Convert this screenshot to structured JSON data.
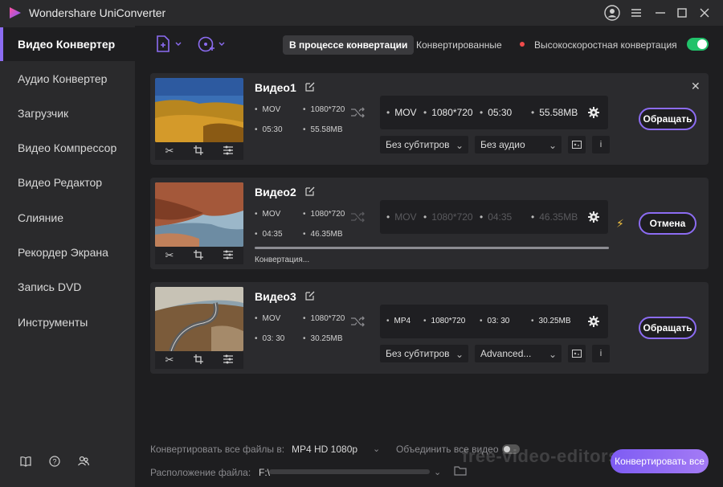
{
  "app": {
    "title": "Wondershare UniConverter"
  },
  "sidebar": {
    "items": [
      {
        "label": "Видео Конвертер",
        "active": true
      },
      {
        "label": "Аудио Конвертер"
      },
      {
        "label": "Загрузчик"
      },
      {
        "label": "Видео Компрессор"
      },
      {
        "label": "Видео Редактор"
      },
      {
        "label": "Слияние"
      },
      {
        "label": "Рекордер Экрана"
      },
      {
        "label": "Запись DVD"
      },
      {
        "label": "Инструменты"
      }
    ],
    "bottom_icons": [
      "book-icon",
      "help-icon",
      "users-icon"
    ]
  },
  "toolbar": {
    "tabs": [
      {
        "label": "В процессе конвертации",
        "active": true
      },
      {
        "label": "Конвертированные"
      }
    ],
    "high_speed_label": "Высокоскоростная конвертация",
    "high_speed_on": true
  },
  "videos": [
    {
      "title": "Видео1",
      "src_format": "MOV",
      "src_res": "1080*720",
      "src_duration": "05:30",
      "src_size": "55.58MB",
      "tgt_format": "MOV",
      "tgt_res": "1080*720",
      "tgt_duration": "05:30",
      "tgt_size": "55.58MB",
      "subtitle": "Без субтитров",
      "audio": "Без аудио",
      "action": "Обращать"
    },
    {
      "title": "Видео2",
      "src_format": "MOV",
      "src_res": "1080*720",
      "src_duration": "04:35",
      "src_size": "46.35MB",
      "tgt_format": "MOV",
      "tgt_res": "1080*720",
      "tgt_duration": "04:35",
      "tgt_size": "46.35MB",
      "status": "Конвертация...",
      "progress": 1.0,
      "action": "Отмена"
    },
    {
      "title": "Видео3",
      "src_format": "MOV",
      "src_res": "1080*720",
      "src_duration": "03: 30",
      "src_size": "30.25MB",
      "tgt_format": "MP4",
      "tgt_res": "1080*720",
      "tgt_duration": "03: 30",
      "tgt_size": "30.25MB",
      "subtitle": "Без субтитров",
      "audio": "Advanced...",
      "action": "Обращать"
    }
  ],
  "footer": {
    "convert_all_label": "Конвертировать все файлы в:",
    "convert_all_value": "MP4 HD 1080p",
    "merge_label": "Объединить все видео",
    "location_label": "Расположение файла:",
    "location_value": "F:\\",
    "convert_all_button": "Конвертировать все"
  },
  "watermark": "free-video-editors.ru",
  "colors": {
    "accent": "#8c6cf2",
    "toggle_on": "#21c26a",
    "bolt": "#f3c340"
  }
}
